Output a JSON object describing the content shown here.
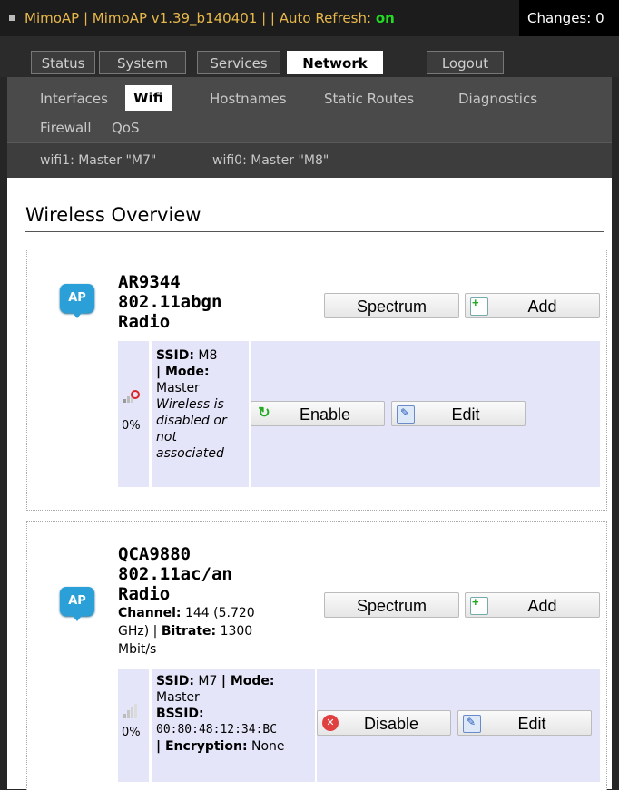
{
  "header": {
    "title_prefix": "MimoAP | MimoAP v1.39_b140401 | | Auto Refresh: ",
    "auto_refresh": "on",
    "changes": "Changes: 0"
  },
  "tabs": [
    {
      "label": "Status"
    },
    {
      "label": "System"
    },
    {
      "label": "Services"
    },
    {
      "label": "Network"
    },
    {
      "label": "Logout"
    }
  ],
  "subtabs": {
    "interfaces": "Interfaces",
    "wifi": "Wifi",
    "hostnames": "Hostnames",
    "static_routes": "Static Routes",
    "diagnostics": "Diagnostics",
    "firewall": "Firewall",
    "qos": "QoS"
  },
  "radio_tabs": [
    "wifi1: Master \"M7\"",
    "wifi0: Master \"M8\""
  ],
  "page_title": "Wireless Overview",
  "devices": [
    {
      "icon_label": "AP",
      "name": [
        "AR9344",
        "802.11abgn",
        "Radio"
      ],
      "spectrum_label": "Spectrum",
      "add_label": "Add",
      "signal": "0%",
      "ssid_label": "SSID:",
      "ssid": "M8",
      "mode_label": "| Mode:",
      "mode": "Master",
      "status_lines": [
        "Wireless is",
        "disabled or",
        "not",
        "associated"
      ],
      "toggle_label": "Enable",
      "edit_label": "Edit"
    },
    {
      "icon_label": "AP",
      "name": [
        "QCA9880",
        "802.11ac/an",
        "Radio"
      ],
      "channel_label": "Channel:",
      "channel_value": "144 (5.720",
      "channel_line2a": "GHz) | ",
      "bitrate_label": "Bitrate:",
      "bitrate_value": "1300",
      "channel_line3": "Mbit/s",
      "spectrum_label": "Spectrum",
      "add_label": "Add",
      "signal": "0%",
      "ssid_label": "SSID:",
      "ssid": "M7",
      "mode_label": "| Mode:",
      "mode": "Master",
      "bssid_label": "BSSID:",
      "bssid": "00:80:48:12:34:BC",
      "enc_label": "| Encryption:",
      "enc": "None",
      "toggle_label": "Disable",
      "edit_label": "Edit"
    }
  ],
  "colors": {
    "brand_text": "#e8b84a",
    "refresh_on": "#22dd22",
    "ap_icon": "#2a9fd8",
    "panel_bg": "#e4e5f8"
  }
}
